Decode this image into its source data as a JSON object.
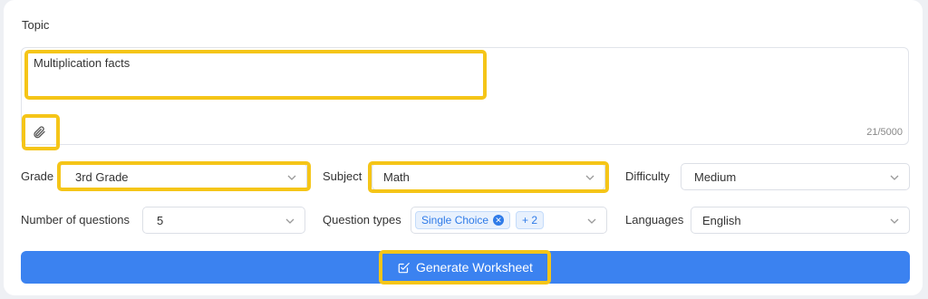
{
  "topic": {
    "label": "Topic",
    "value": "Multiplication facts",
    "char_count": "21/5000"
  },
  "grade": {
    "label": "Grade",
    "value": "3rd Grade"
  },
  "subject": {
    "label": "Subject",
    "value": "Math"
  },
  "difficulty": {
    "label": "Difficulty",
    "value": "Medium"
  },
  "num_questions": {
    "label": "Number of questions",
    "value": "5"
  },
  "question_types": {
    "label": "Question types",
    "tag": "Single Choice",
    "more": "+ 2"
  },
  "languages": {
    "label": "Languages",
    "value": "English"
  },
  "generate": {
    "label": "Generate Worksheet"
  },
  "colors": {
    "accent": "#3b82f0",
    "highlight": "#f5c518",
    "tag_blue": "#2f7be8"
  },
  "icons": [
    "paperclip-icon",
    "chevron-down-icon",
    "close-circle-icon",
    "edit-check-icon"
  ]
}
